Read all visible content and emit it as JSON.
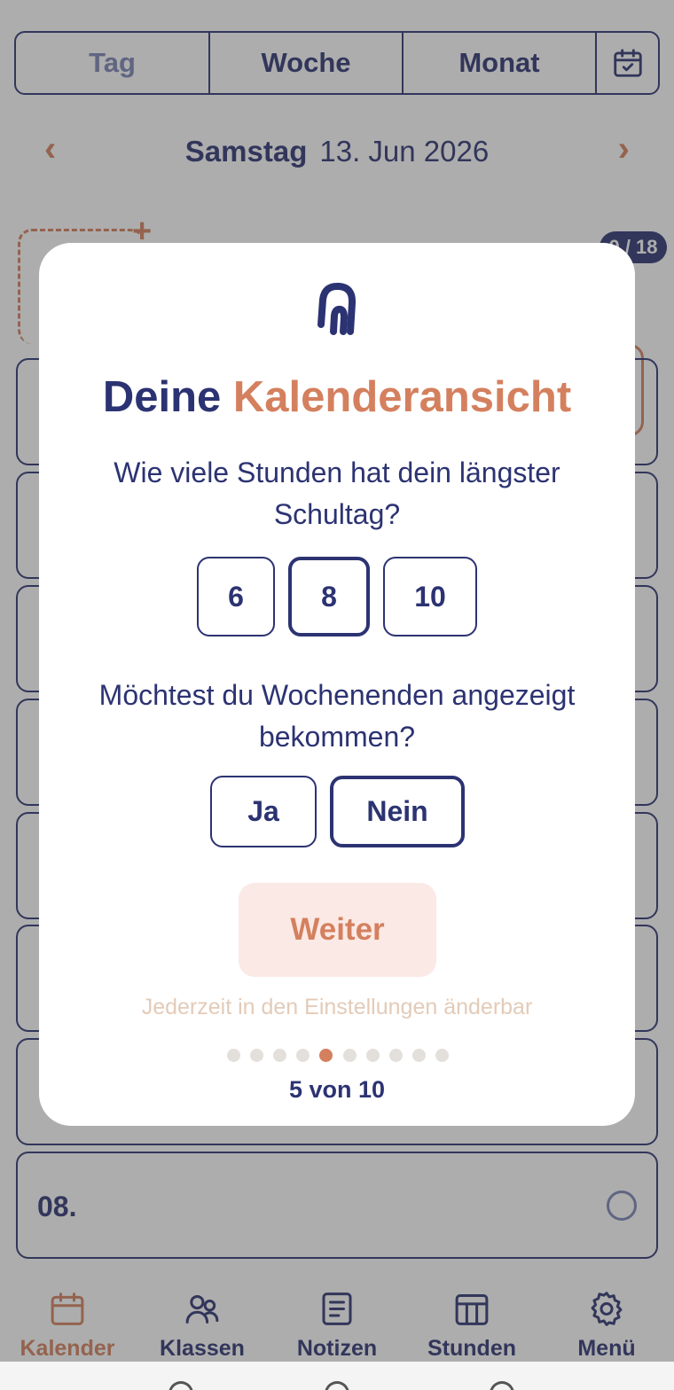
{
  "header": {
    "view_tabs": [
      "Tag",
      "Woche",
      "Monat"
    ],
    "date_weekday": "Samstag",
    "date_value": "13. Jun 2026",
    "prev_arrow": "‹",
    "next_arrow": "›"
  },
  "schedule": {
    "add_symbol": "+",
    "counter_badge": "0 / 18",
    "visible_hour_label": "08."
  },
  "bottom_nav": [
    {
      "label": "Kalender",
      "icon": "calendar-icon",
      "active": true
    },
    {
      "label": "Klassen",
      "icon": "people-icon",
      "active": false
    },
    {
      "label": "Notizen",
      "icon": "note-icon",
      "active": false
    },
    {
      "label": "Stunden",
      "icon": "timetable-icon",
      "active": false
    },
    {
      "label": "Menü",
      "icon": "gear-icon",
      "active": false
    }
  ],
  "modal": {
    "logo_icon": "magnet-logo-icon",
    "title_part1": "Deine",
    "title_part2": "Kalenderansicht",
    "question1": "Wie viele Stunden hat dein längster Schultag?",
    "hour_options": [
      "6",
      "8",
      "10"
    ],
    "hour_selected": "8",
    "question2": "Möchtest du Wochenenden angezeigt bekommen?",
    "weekend_options": [
      "Ja",
      "Nein"
    ],
    "weekend_selected": "Nein",
    "continue_label": "Weiter",
    "hint": "Jederzeit in den Einstellungen änderbar",
    "step_current": 5,
    "step_total": 10,
    "progress_text": "5 von 10"
  },
  "colors": {
    "navy": "#2c3372",
    "accent": "#d4805e",
    "accent_light": "#fbe9e5",
    "muted": "#7b84b5"
  }
}
